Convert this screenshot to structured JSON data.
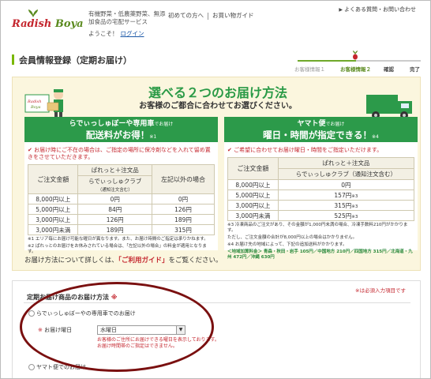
{
  "header": {
    "logo_prefix": "Radish",
    "logo_suffix": "Boya",
    "tagline": "有機野菜・低農薬野菜、無添加食品の宅配サービス",
    "nav": [
      "初めての方へ",
      "お買い物ガイド"
    ],
    "top_link": "よくある質問・お問い合わせ",
    "welcome": "ようこそ！",
    "login": "ログイン"
  },
  "page": {
    "title": "会員情報登録（定期お届け）",
    "steps": [
      "お客様情報１",
      "お客様情報２",
      "確認",
      "完了"
    ]
  },
  "banner": {
    "title": "選べる２つのお届け方法",
    "subtitle": "お客様のご都合に合わせてお選びください。",
    "left": {
      "head1": "らでぃっしゅぼーや専用車",
      "head1_small": "でお届け",
      "head2": "配送料がお得！",
      "head2_small": "※1",
      "note": "お届け時にご不在の場合は、ご指定の場所に保冷剤などを入れて留め置きをさせていただきます。",
      "col_amount": "ご注文金額",
      "col_member": "ぱれっと＋注文品",
      "col_member_sub": "らでぃっしゅクラブ",
      "col_member_note": "（通知注文含む）",
      "col_other": "左記以外の場合",
      "rows": [
        [
          "8,000円以上",
          "0円",
          "0円"
        ],
        [
          "5,000円以上",
          "84円",
          "126円"
        ],
        [
          "3,000円以上",
          "126円",
          "189円"
        ],
        [
          "3,000円未満",
          "189円",
          "315円"
        ]
      ],
      "fn1": "※1 エリア毎にお届け可能な曜日が異なります。また、お届け時間のご指定は承りかねます。",
      "fn2": "※2 ぱれっとのお届けをお休みされている場合は、「左記以外の場合」の料金が適用となります。"
    },
    "right": {
      "head1": "ヤマト便",
      "head1_small": "でお届け",
      "head2": "曜日・時間が指定できる！",
      "head2_small": "※4",
      "note": "ご希望に合わせてお届け曜日・時間をご指定いただけます。",
      "col_amount": "ご注文金額",
      "col_member": "ぱれっと＋注文品",
      "col_member_sub": "らでぃっしゅクラブ（通知注文含む）",
      "rows": [
        [
          "8,000円以上",
          "0円"
        ],
        [
          "5,000円以上",
          "157円",
          "※3"
        ],
        [
          "3,000円以上",
          "315円",
          "※3"
        ],
        [
          "3,000円未満",
          "525円",
          "※3"
        ]
      ],
      "fn1": "※3 冷凍商品のご注文があり、その金額が1,000円未満の場合、冷凍手数料210円がかかります。",
      "fn2": "ただし、ご注文金額の合計が8,000円以上の場合はかかりません。",
      "fn3": "※4 お届け先の地域によって、下記の追加送料がかかります。",
      "fn4": "＜地域加算料金＞ 青森・秋田・岩手 105円／中国地方 210円／四国地方 315円／北海道・九州 472円／沖縄 630円"
    },
    "footer_pre": "お届け方法について詳しくは、",
    "footer_link": "「ご利用ガイド」",
    "footer_post": "をご覧ください。"
  },
  "form": {
    "required_note": "※は必須入力項目です",
    "section_title": "定期お届け商品のお届け方法",
    "section_req": "※",
    "option1": "らでぃっしゅぼーやの専用車でのお届け",
    "day_label": "お届け曜日",
    "day_req": "※",
    "day_value": "水曜日",
    "help1": "お客様のご住所にお届けできる曜日を表示しております。",
    "help2": "お届け時間帯のご指定はできません。",
    "option2": "ヤマト便でのお届け"
  },
  "colors": {
    "green": "#2c9a4a",
    "red": "#c4262e",
    "cream": "#fbf6de",
    "annotation": "#7a1010"
  }
}
